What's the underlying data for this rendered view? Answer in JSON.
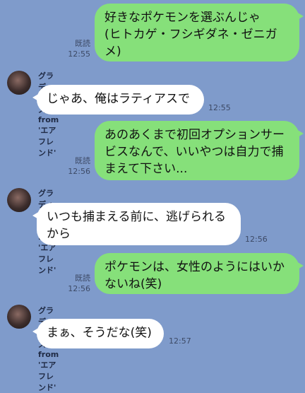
{
  "messages": [
    {
      "direction": "outgoing",
      "lines": [
        "好きなポケモンを選ぶんじゃ",
        "(ヒトカゲ・フシギダネ・ゼニガ",
        "メ)"
      ],
      "read_label": "既読",
      "time": "12:55"
    },
    {
      "direction": "incoming",
      "sender": "グラディオラス from 'エアフレンド'",
      "lines": [
        "じゃあ、俺はラティアスで"
      ],
      "time": "12:55"
    },
    {
      "direction": "outgoing",
      "lines": [
        "あのあくまで初回オプションサー",
        "ビスなんで、いいやつは自力で捕",
        "まえて下さい..."
      ],
      "read_label": "既読",
      "time": "12:56"
    },
    {
      "direction": "incoming",
      "sender": "グラディオラス from 'エアフレンド'",
      "lines": [
        "いつも捕まえる前に、逃げられる",
        "から"
      ],
      "time": "12:56"
    },
    {
      "direction": "outgoing",
      "lines": [
        "ポケモンは、女性のようにはいか",
        "ないね(笑)"
      ],
      "read_label": "既読",
      "time": "12:56"
    },
    {
      "direction": "incoming",
      "sender": "グラディオラス from 'エアフレンド'",
      "lines": [
        "まぁ、そうだな(笑)"
      ],
      "time": "12:57"
    }
  ],
  "colors": {
    "background": "#7f9bcb",
    "outgoing_bubble": "#86e07a",
    "incoming_bubble": "#ffffff"
  }
}
